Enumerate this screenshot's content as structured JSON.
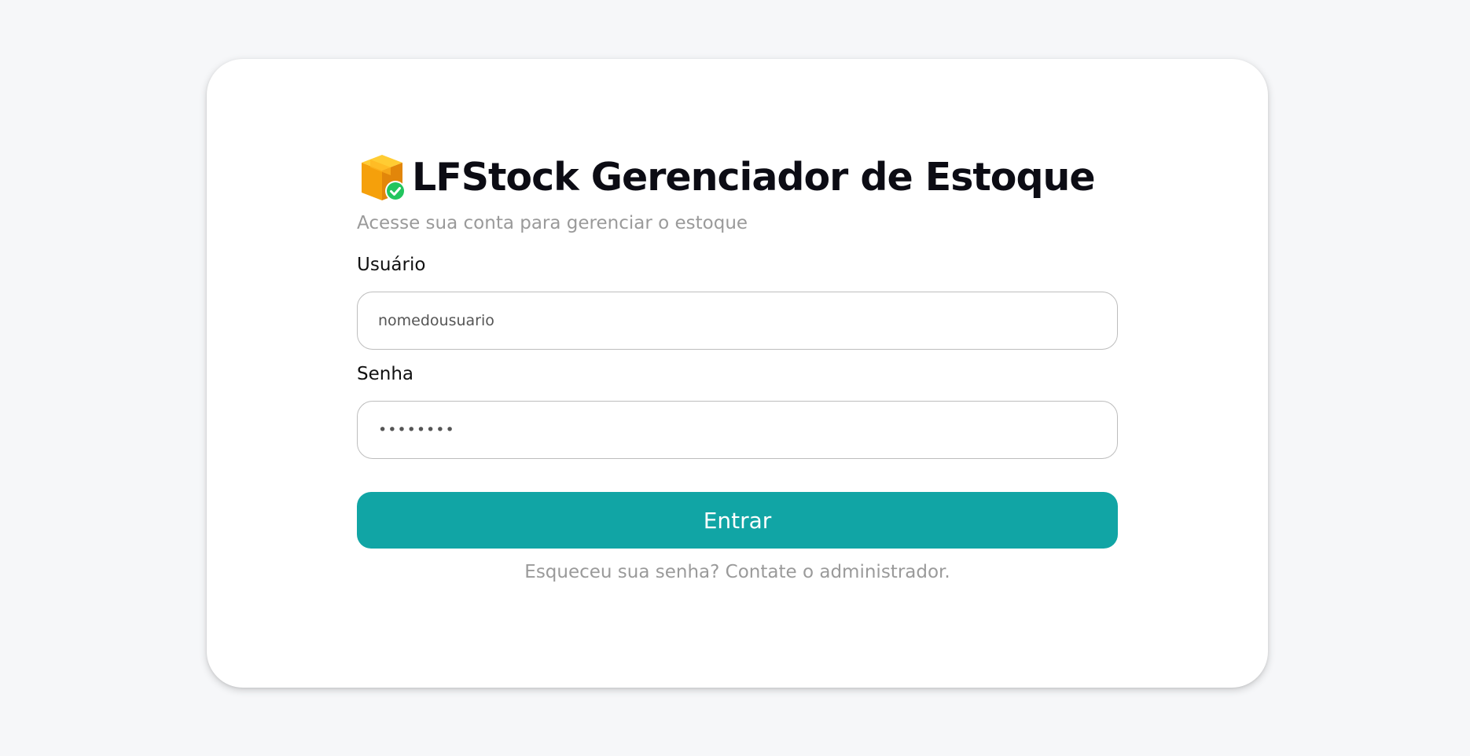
{
  "header": {
    "icon": "package-box-with-checkmark-icon",
    "title": "LFStock Gerenciador de Estoque",
    "subtitle": "Acesse sua conta para gerenciar o estoque"
  },
  "form": {
    "username_label": "Usuário",
    "username_value": "nomedousuario",
    "password_label": "Senha",
    "password_value": "••••••••",
    "submit_label": "Entrar",
    "forgot_text": "Esqueceu sua senha? Contate o administrador."
  },
  "colors": {
    "page_background": "#f6f7f9",
    "card_background": "#ffffff",
    "accent": "#11a5a5",
    "muted_text": "#9a9a9a",
    "check_badge": "#22c55e",
    "box_orange": "#f59e0b"
  }
}
